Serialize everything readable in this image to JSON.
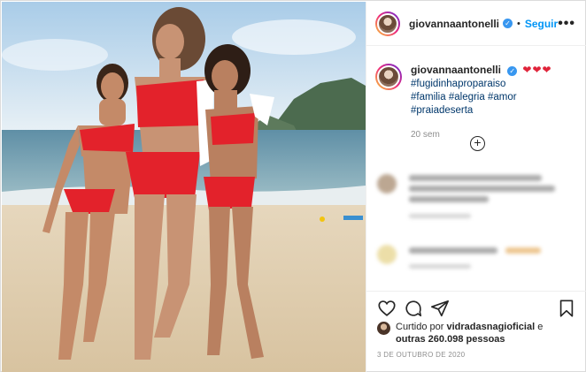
{
  "post": {
    "username": "giovannaantonelli",
    "verified_mark": "✓",
    "separator": "•",
    "follow_label": "Seguir",
    "more_label": "•••",
    "caption_username": "giovannaantonelli",
    "caption_hearts": "❤❤❤",
    "hashtags_line1": "#fugidinhaproparaiso",
    "hashtags": [
      "#familia",
      "#alegria",
      "#amor",
      "#praiadeserta"
    ],
    "posted_ago": "20 sem",
    "load_more_label": "+",
    "liked_by_prefix": "Curtido por",
    "liked_by_user": "vidradasnagioficial",
    "liked_by_and": "e",
    "liked_by_others": "outras 260.098 pessoas",
    "date": "3 DE OUTUBRO DE 2020"
  },
  "icons": {
    "like": "heart-icon",
    "comment": "comment-icon",
    "share": "share-icon",
    "save": "bookmark-icon",
    "more": "more-icon",
    "load_more": "plus-circle-icon"
  },
  "colors": {
    "accent": "#0095f6",
    "hashtag": "#00376b",
    "heart": "#e0243a",
    "muted": "#8e8e8e",
    "swimsuit": "#e3222b"
  }
}
